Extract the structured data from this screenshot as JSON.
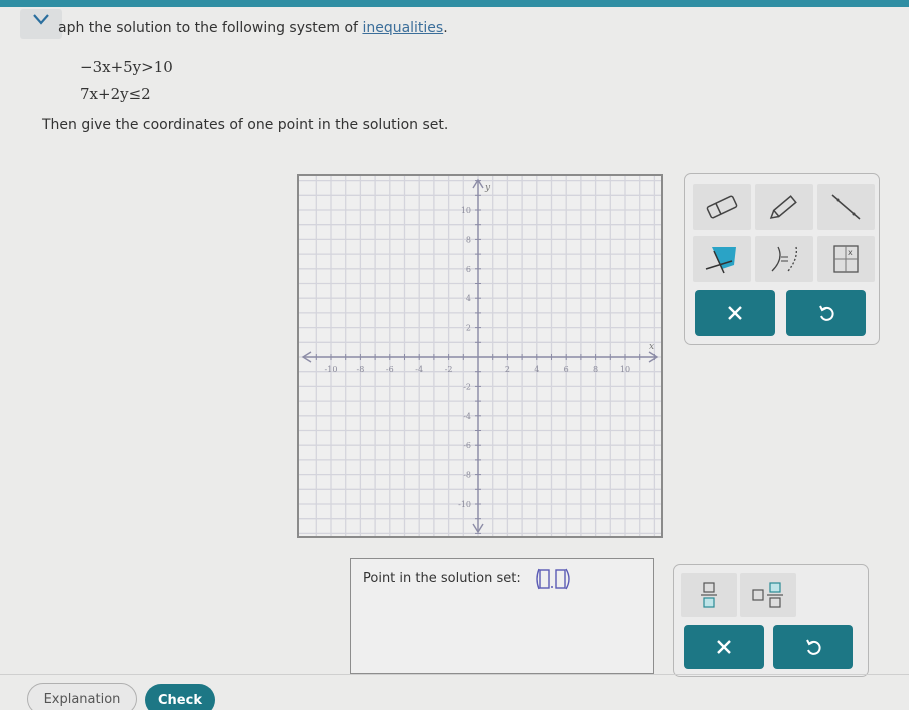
{
  "header": {
    "accent_color": "#2f8ea3",
    "collapse_icon": "chevron-down-icon"
  },
  "question": {
    "prompt_text": "aph the solution to the following system of ",
    "prompt_link": "inequalities",
    "prompt_end": ".",
    "inequalities": [
      "−3x+5y>10",
      "7x+2y≤2"
    ],
    "instruction": "Then give the coordinates of one point in the solution set."
  },
  "graph": {
    "x_label": "x",
    "y_label": "y",
    "x_range": [
      -11.5,
      12
    ],
    "y_range": [
      -12,
      12
    ],
    "x_ticks": [
      "-10",
      "-8",
      "-6",
      "-4",
      "-2",
      "2",
      "4",
      "6",
      "8",
      "10"
    ],
    "y_ticks": [
      "10",
      "8",
      "6",
      "4",
      "2",
      "-2",
      "-4",
      "-6",
      "-8",
      "-10"
    ],
    "grid_step": 1
  },
  "toolbox": {
    "tools": [
      {
        "name": "eraser",
        "icon": "eraser-icon"
      },
      {
        "name": "pencil",
        "icon": "pencil-icon"
      },
      {
        "name": "line",
        "icon": "line-icon"
      },
      {
        "name": "shade-region",
        "icon": "shade-region-icon"
      },
      {
        "name": "solid-dashed-toggle",
        "icon": "solid-dashed-toggle-icon"
      },
      {
        "name": "point",
        "icon": "plot-point-icon"
      }
    ],
    "clear_icon": "close-icon",
    "undo_icon": "undo-icon",
    "shade_color": "#2aa3c6"
  },
  "answer": {
    "label": "Point in the solution set:",
    "ordered_pair_template": "(□,□)",
    "x_value": "",
    "y_value": ""
  },
  "mathpad": {
    "tools": [
      {
        "name": "fraction",
        "icon": "fraction-icon"
      },
      {
        "name": "mixed-number",
        "icon": "mixed-number-icon"
      }
    ],
    "clear_icon": "close-icon",
    "undo_icon": "undo-icon"
  },
  "footer": {
    "explanation_label": "Explanation",
    "check_label": "Check",
    "brand_color": "#1d7785"
  }
}
